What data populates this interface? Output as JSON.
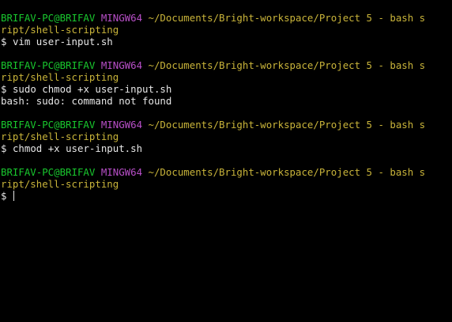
{
  "prompt": {
    "user": "BRIFAV-PC@BRIFAV",
    "host": "MINGW64",
    "path_line1": "~/Documents/Bright-workspace/Project 5 - bash s",
    "path_line2": "ript/shell-scripting",
    "symbol": "$"
  },
  "blocks": [
    {
      "command": "vim user-input.sh",
      "output": ""
    },
    {
      "command": "sudo chmod +x user-input.sh",
      "output": "bash: sudo: command not found"
    },
    {
      "command": "chmod +x user-input.sh",
      "output": ""
    },
    {
      "command": "",
      "output": ""
    }
  ],
  "colors": {
    "background": "#000000",
    "user": "#19c82e",
    "host": "#b84fc8",
    "path": "#c9b43a",
    "text": "#e6e6e6"
  }
}
